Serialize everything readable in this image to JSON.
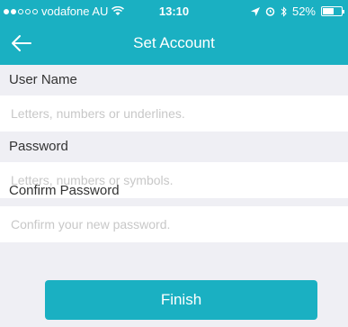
{
  "status_bar": {
    "carrier": "vodafone AU",
    "time": "13:10",
    "battery": "52%",
    "signal_bars_filled": 2,
    "signal_bars_total": 5
  },
  "nav": {
    "title": "Set Account"
  },
  "form": {
    "username_label": "User Name",
    "username_placeholder": "Letters, numbers or underlines.",
    "password_label": "Password",
    "password_placeholder": "Letters, numbers or symbols.",
    "confirm_label": "Confirm Password",
    "confirm_placeholder": "Confirm your new password.",
    "finish_label": "Finish"
  },
  "colors": {
    "accent": "#1ab0c2",
    "background": "#efeff4"
  }
}
